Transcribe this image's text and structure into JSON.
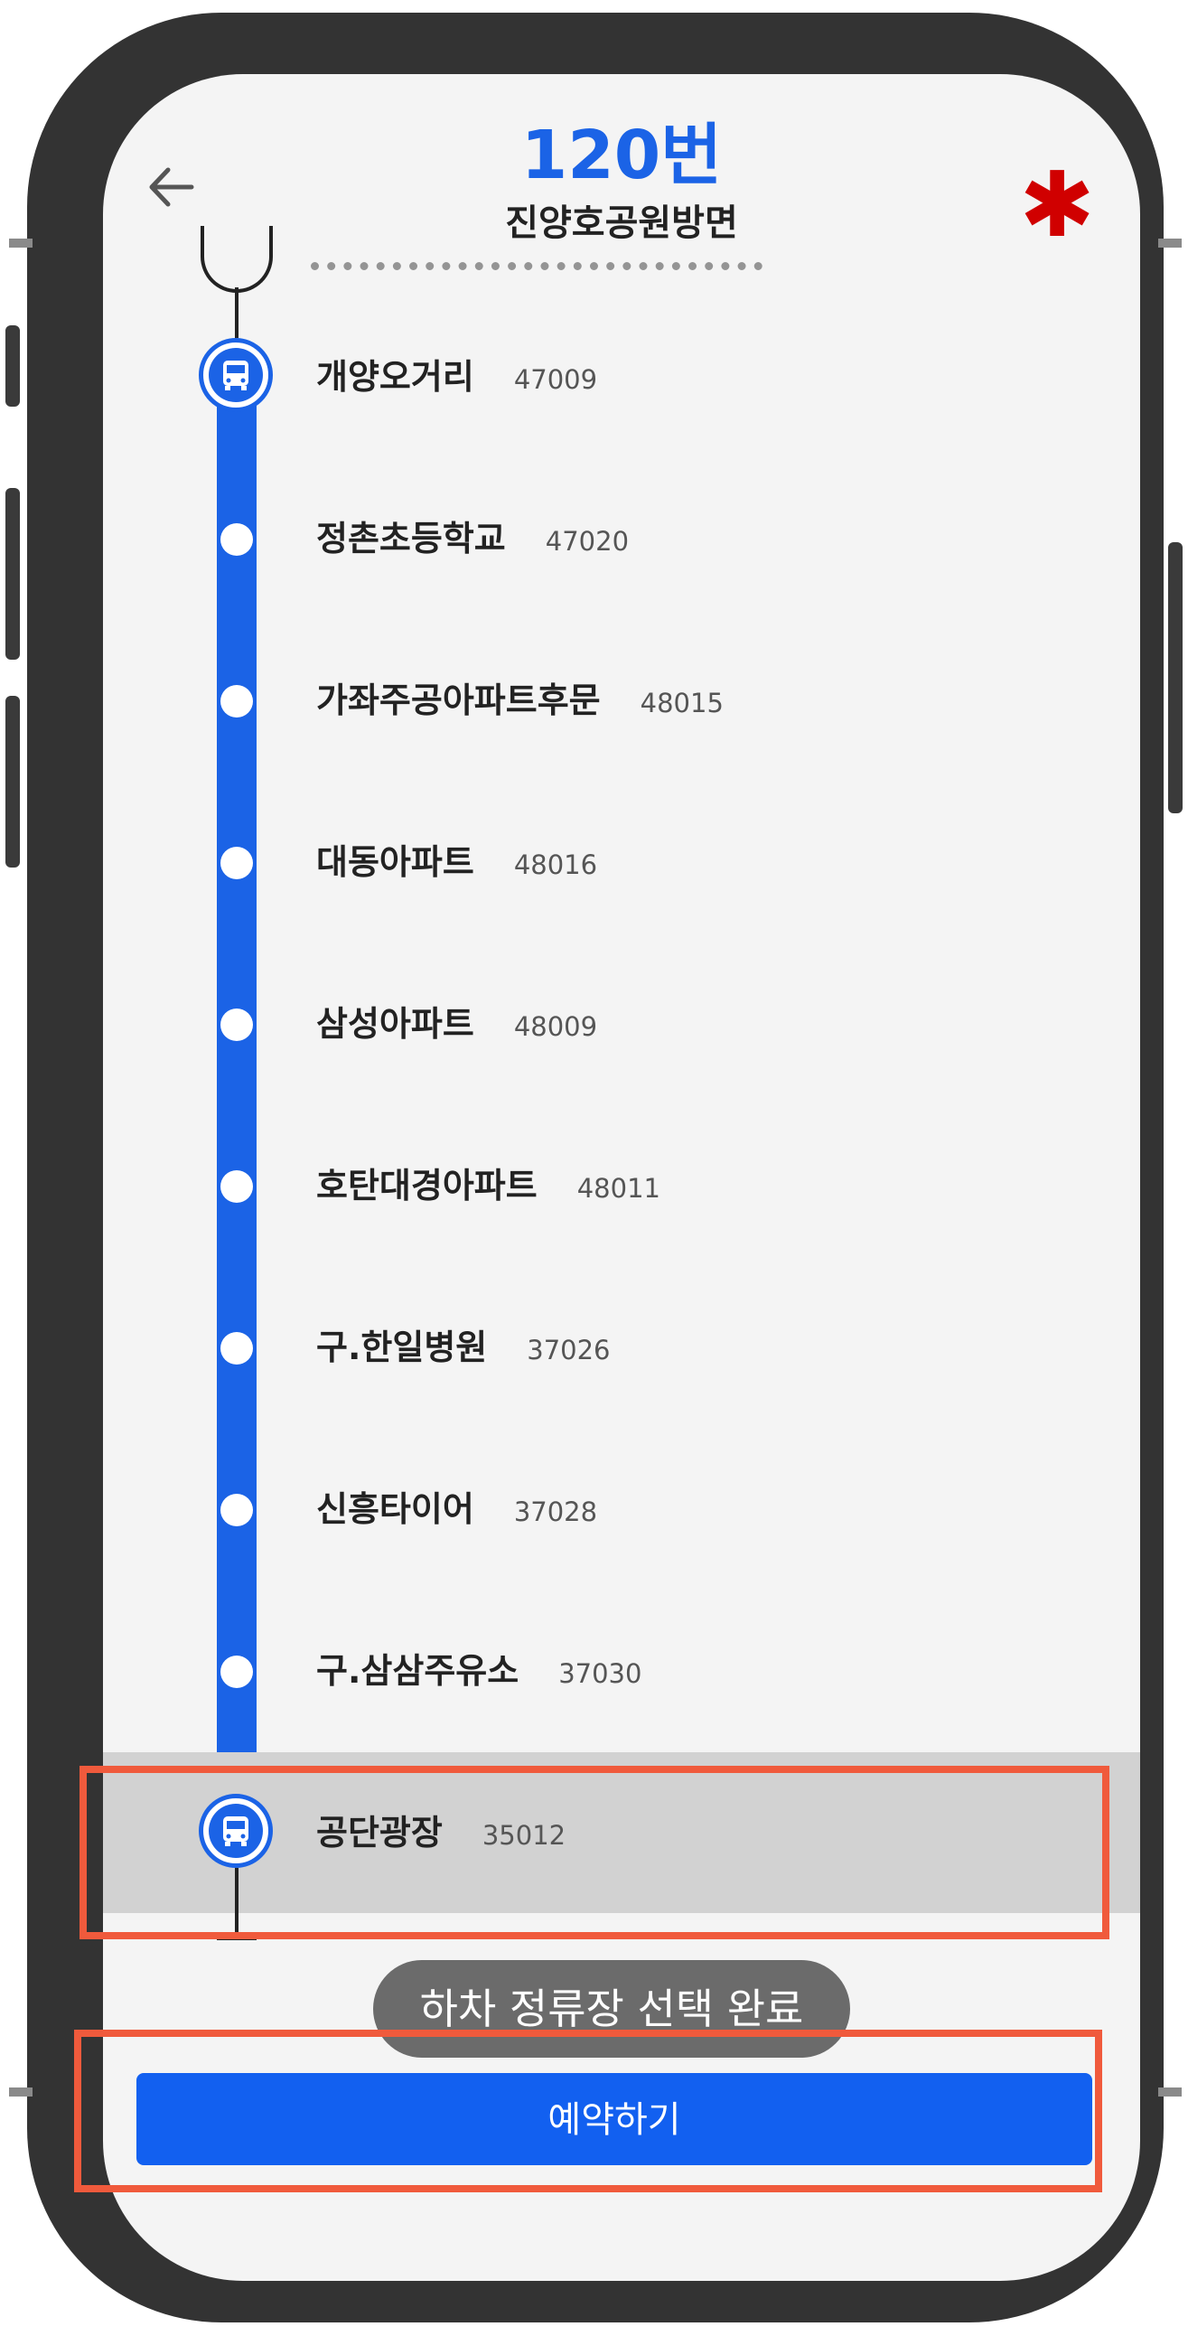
{
  "header": {
    "route_number": "120번",
    "direction": "진양호공원방면"
  },
  "stops": [
    {
      "name": "개양오거리",
      "code": "47009",
      "type": "bus"
    },
    {
      "name": "정촌초등학교",
      "code": "47020",
      "type": "dot"
    },
    {
      "name": "가좌주공아파트후문",
      "code": "48015",
      "type": "dot"
    },
    {
      "name": "대동아파트",
      "code": "48016",
      "type": "dot"
    },
    {
      "name": "삼성아파트",
      "code": "48009",
      "type": "dot"
    },
    {
      "name": "호탄대경아파트",
      "code": "48011",
      "type": "dot"
    },
    {
      "name": "구.한일병원",
      "code": "37026",
      "type": "dot"
    },
    {
      "name": "신흥타이어",
      "code": "37028",
      "type": "dot"
    },
    {
      "name": "구.삼삼주유소",
      "code": "37030",
      "type": "dot"
    },
    {
      "name": "공단광장",
      "code": "35012",
      "type": "bus",
      "selected": true
    }
  ],
  "toast": "하차 정류장 선택 완료",
  "reserve_button": "예약하기",
  "colors": {
    "accent": "#1b63e6",
    "asterisk": "#d00000",
    "highlight": "#f05a3c"
  }
}
